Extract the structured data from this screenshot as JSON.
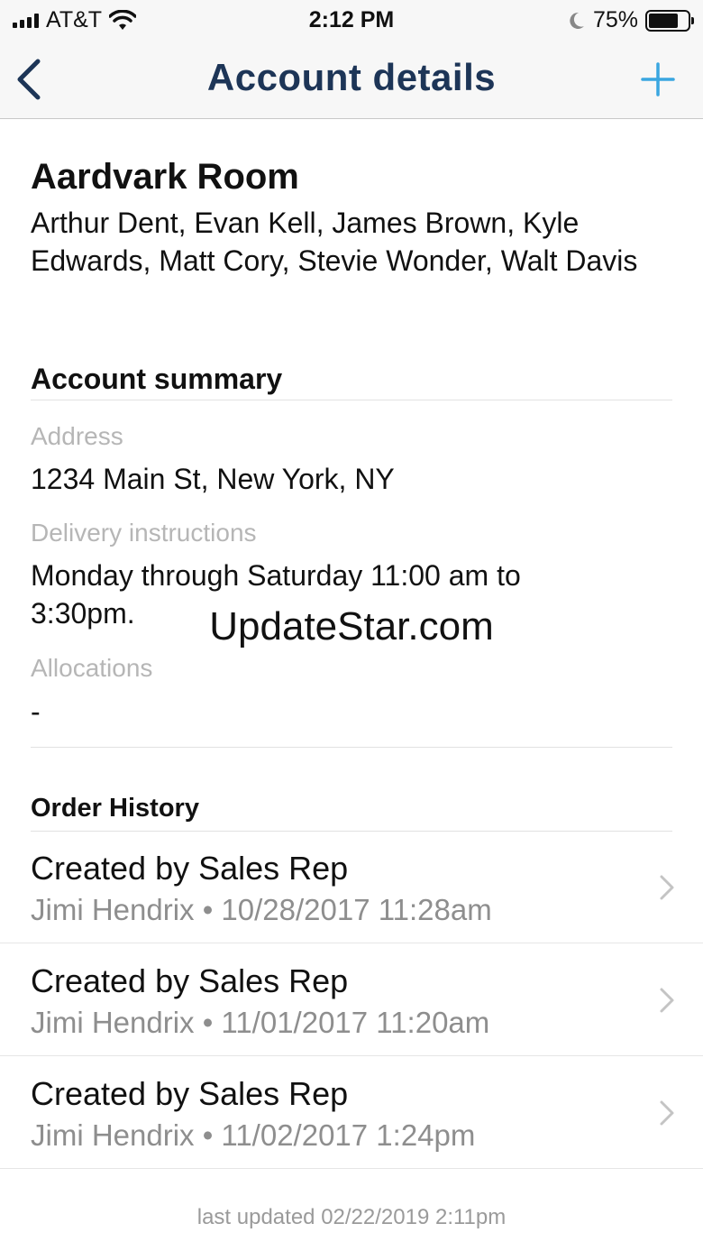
{
  "status_bar": {
    "carrier": "AT&T",
    "time": "2:12 PM",
    "battery_percent": "75%",
    "battery_level": 0.75,
    "icons": [
      "signal-icon",
      "wifi-icon",
      "moon-icon",
      "battery-icon"
    ]
  },
  "nav": {
    "title": "Account details",
    "back_icon": "chevron-left-icon",
    "add_icon": "plus-icon",
    "title_color": "#1d3557",
    "accent_color": "#3aa6e0"
  },
  "account": {
    "name": "Aardvark Room",
    "members": "Arthur Dent, Evan Kell, James Brown, Kyle Edwards, Matt Cory, Stevie Wonder, Walt Davis"
  },
  "summary": {
    "title": "Account summary",
    "address_label": "Address",
    "address_value": "1234 Main St, New York, NY",
    "delivery_label": "Delivery instructions",
    "delivery_value": "Monday through Saturday 11:00 am to 3:30pm.",
    "allocations_label": "Allocations",
    "allocations_value": "-"
  },
  "watermark": "UpdateStar.com",
  "order_history": {
    "title": "Order History",
    "items": [
      {
        "title": "Created by Sales Rep",
        "meta": "Jimi Hendrix • 10/28/2017 11:28am"
      },
      {
        "title": "Created by Sales Rep",
        "meta": "Jimi Hendrix • 11/01/2017 11:20am"
      },
      {
        "title": "Created by Sales Rep",
        "meta": "Jimi Hendrix • 11/02/2017 1:24pm"
      }
    ]
  },
  "footer": {
    "last_updated": "last updated 02/22/2019 2:11pm"
  }
}
